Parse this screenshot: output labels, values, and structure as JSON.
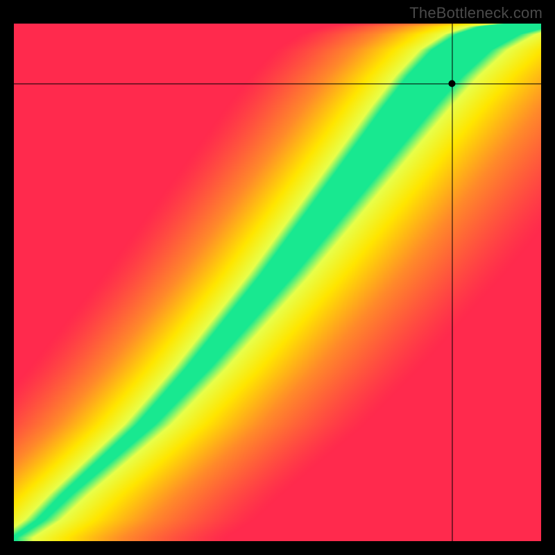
{
  "watermark": "TheBottleneck.com",
  "chart_data": {
    "type": "heatmap",
    "title": "",
    "xlabel": "",
    "ylabel": "",
    "xlim": [
      0,
      100
    ],
    "ylim": [
      0,
      100
    ],
    "grid": false,
    "legend": false,
    "crosshair": {
      "x_frac": 0.832,
      "y_frac_from_top": 0.116
    },
    "marker": {
      "x_frac": 0.832,
      "y_frac_from_top": 0.116,
      "radius_px": 5
    },
    "color_stops": [
      {
        "t": 0.0,
        "hex": "#ff2a4d"
      },
      {
        "t": 0.4,
        "hex": "#ff8a2a"
      },
      {
        "t": 0.7,
        "hex": "#ffe600"
      },
      {
        "t": 0.9,
        "hex": "#e8ff4a"
      },
      {
        "t": 1.0,
        "hex": "#18e890"
      }
    ],
    "ridge": {
      "description": "peak (green) curve as y_frac_from_top for each x_frac",
      "points": [
        {
          "x": 0.0,
          "y": 0.994
        },
        {
          "x": 0.05,
          "y": 0.96
        },
        {
          "x": 0.1,
          "y": 0.91
        },
        {
          "x": 0.15,
          "y": 0.865
        },
        {
          "x": 0.2,
          "y": 0.82
        },
        {
          "x": 0.25,
          "y": 0.775
        },
        {
          "x": 0.3,
          "y": 0.72
        },
        {
          "x": 0.35,
          "y": 0.665
        },
        {
          "x": 0.4,
          "y": 0.605
        },
        {
          "x": 0.45,
          "y": 0.545
        },
        {
          "x": 0.5,
          "y": 0.485
        },
        {
          "x": 0.55,
          "y": 0.42
        },
        {
          "x": 0.6,
          "y": 0.355
        },
        {
          "x": 0.65,
          "y": 0.29
        },
        {
          "x": 0.7,
          "y": 0.225
        },
        {
          "x": 0.75,
          "y": 0.16
        },
        {
          "x": 0.8,
          "y": 0.1
        },
        {
          "x": 0.85,
          "y": 0.05
        },
        {
          "x": 0.9,
          "y": 0.02
        },
        {
          "x": 0.95,
          "y": 0.005
        },
        {
          "x": 1.0,
          "y": 0.0
        }
      ]
    },
    "ridge_width": {
      "description": "half-width of band in x_frac where value is near 1.0",
      "points": [
        {
          "x": 0.0,
          "w": 0.005
        },
        {
          "x": 0.1,
          "w": 0.01
        },
        {
          "x": 0.3,
          "w": 0.02
        },
        {
          "x": 0.5,
          "w": 0.032
        },
        {
          "x": 0.7,
          "w": 0.045
        },
        {
          "x": 0.9,
          "w": 0.06
        },
        {
          "x": 1.0,
          "w": 0.07
        }
      ]
    }
  }
}
